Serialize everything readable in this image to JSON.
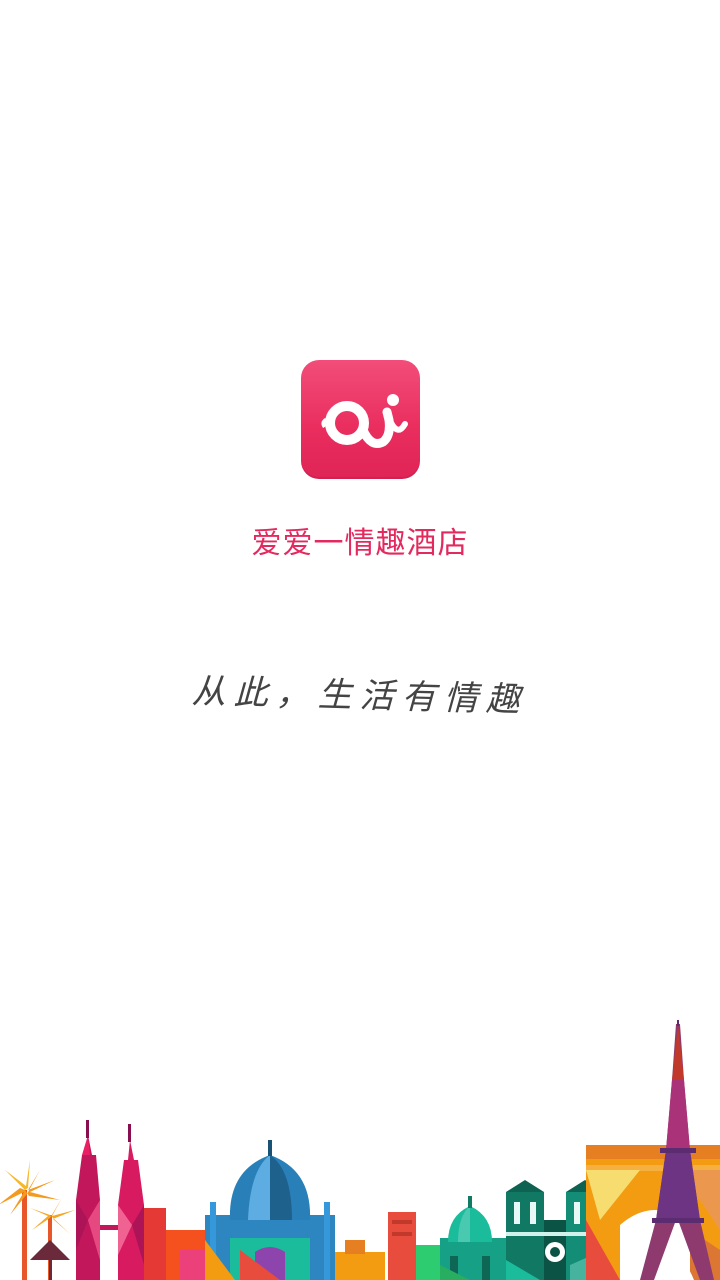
{
  "splash": {
    "app_name": "爱爱一情趣酒店",
    "slogan": "从此，生活有情趣",
    "logo_icon": "ai-logo-icon",
    "skyline_icon": "city-skyline-illustration"
  },
  "colors": {
    "brand": "#e32a5f",
    "background": "#ffffff",
    "slogan_text": "#444444"
  }
}
